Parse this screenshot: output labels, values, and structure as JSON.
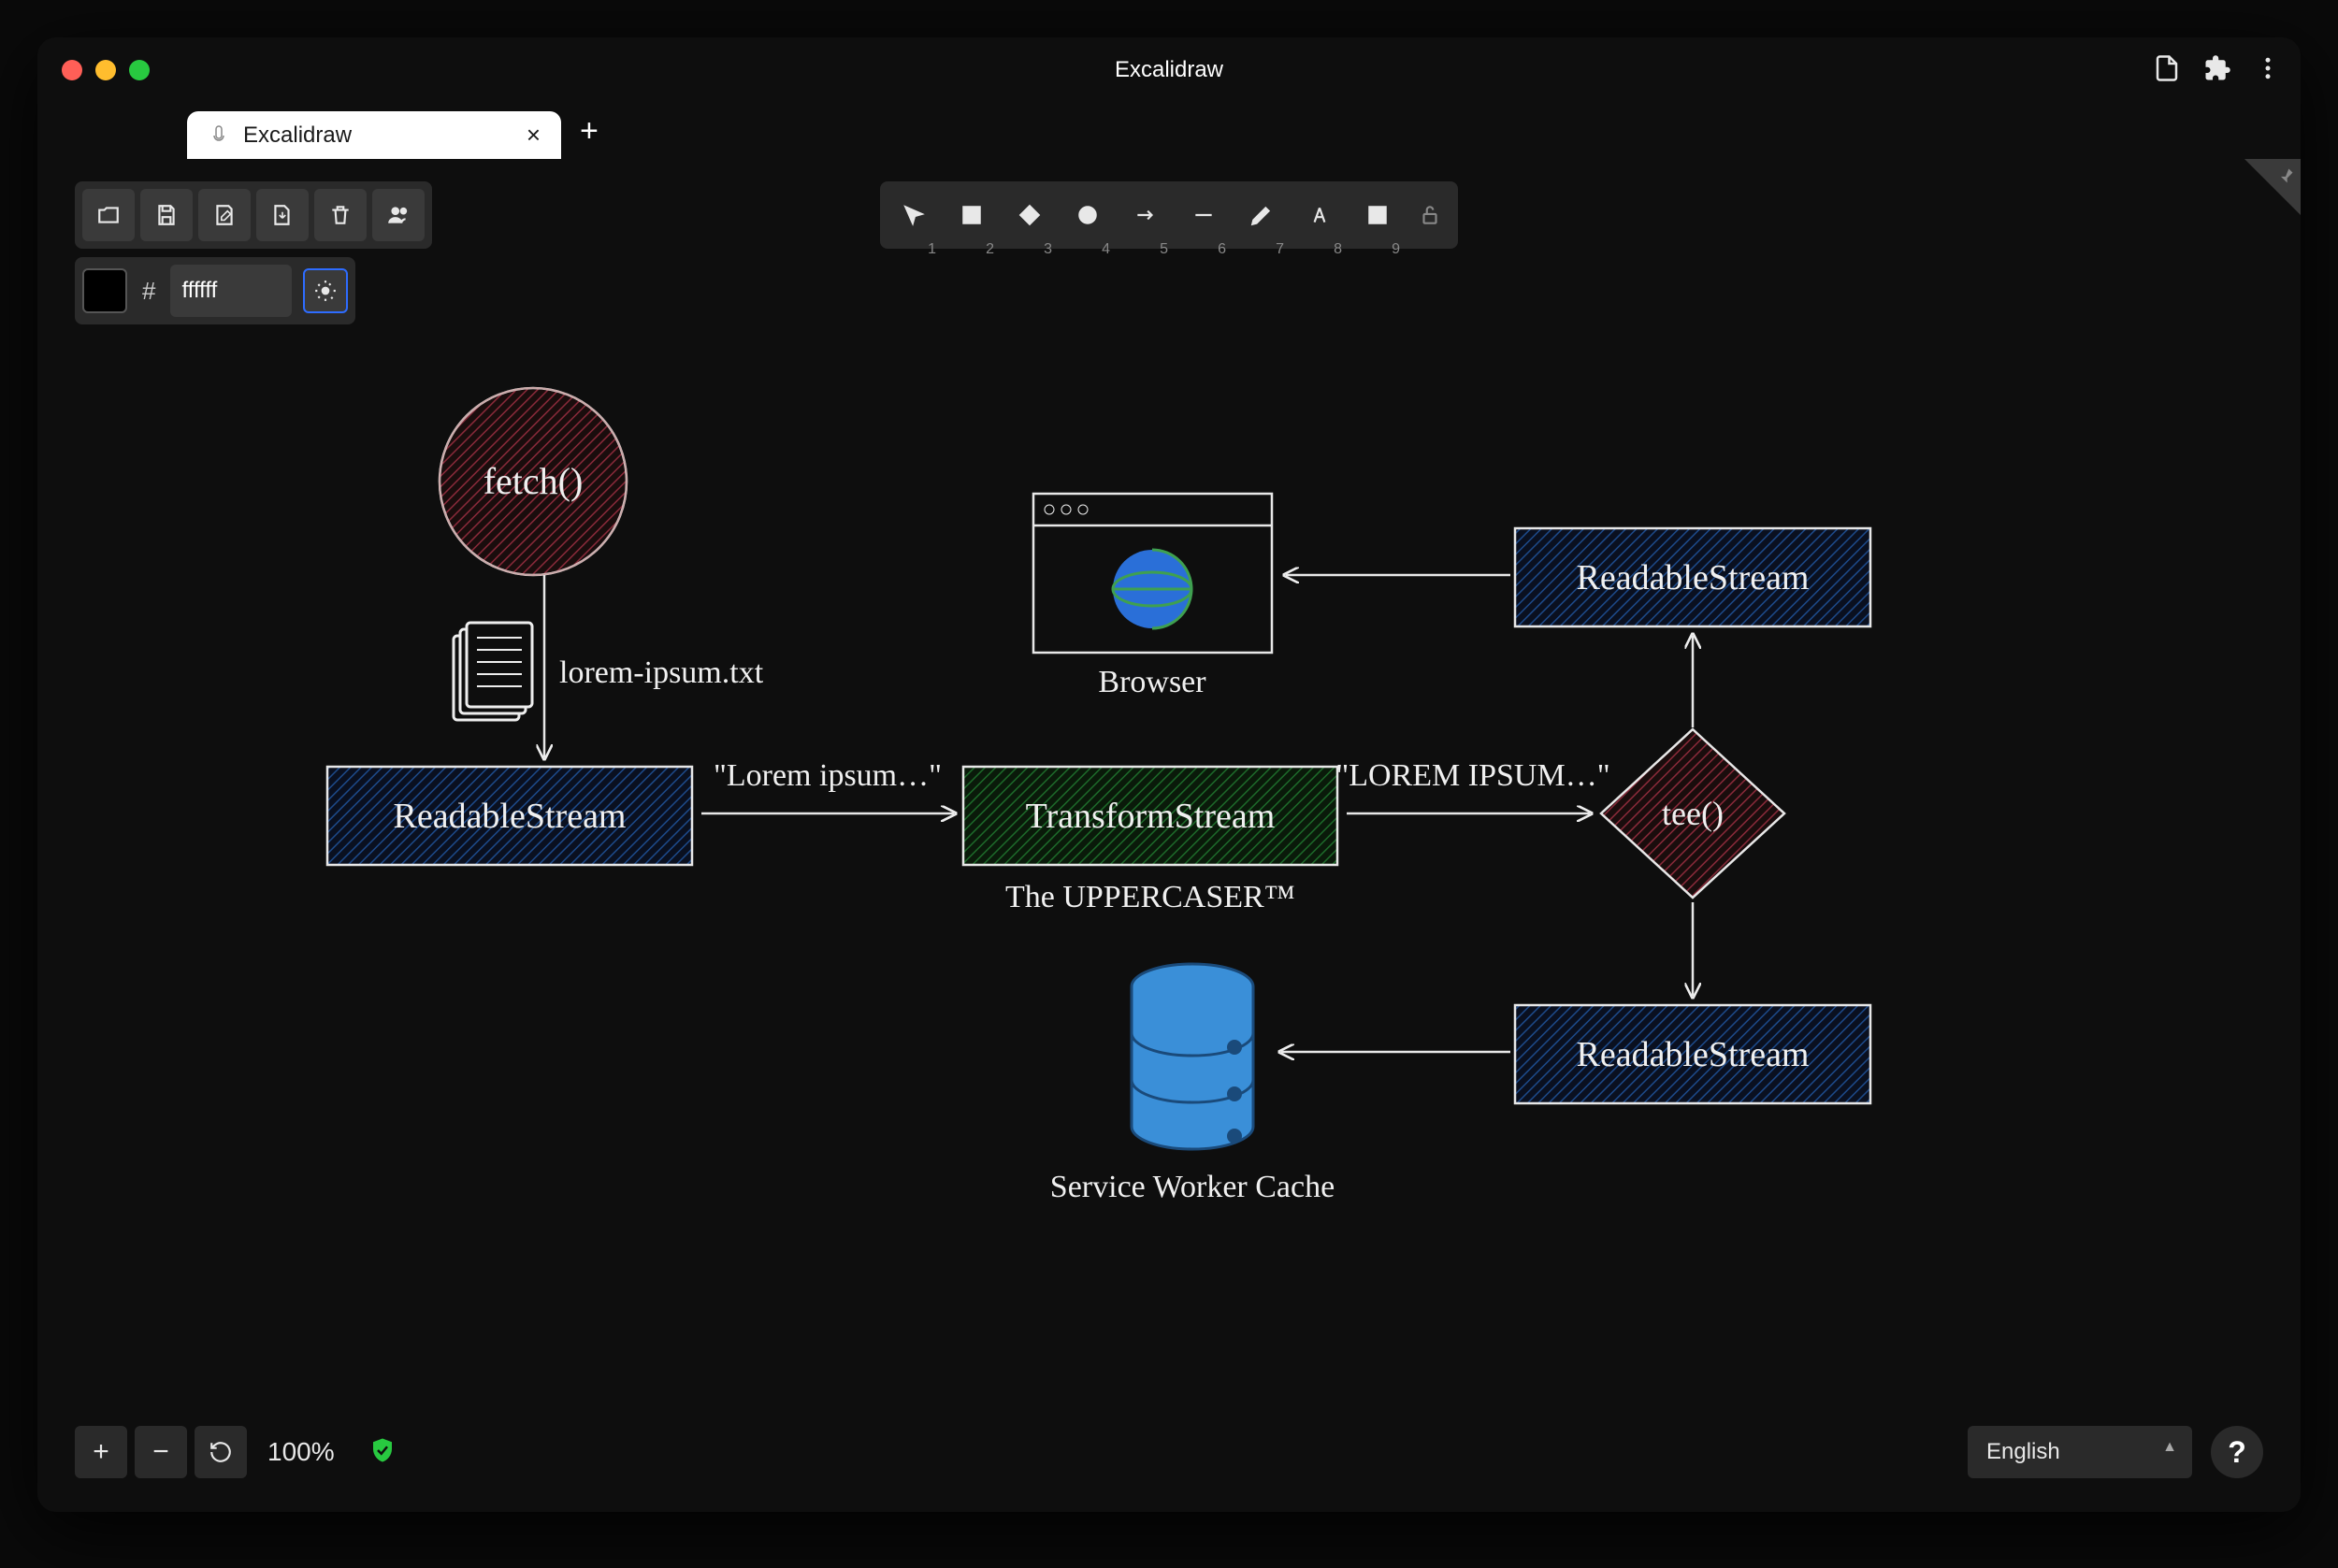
{
  "window": {
    "title": "Excalidraw"
  },
  "tab": {
    "title": "Excalidraw"
  },
  "color": {
    "hex": "ffffff"
  },
  "zoom": {
    "level": "100%"
  },
  "language": {
    "selected": "English"
  },
  "tools": {
    "idx1": "1",
    "idx2": "2",
    "idx3": "3",
    "idx4": "4",
    "idx5": "5",
    "idx6": "6",
    "idx7": "7",
    "idx8": "8",
    "idx9": "9"
  },
  "diagram": {
    "fetch_label": "fetch()",
    "file_label": "lorem-ipsum.txt",
    "readable1": "ReadableStream",
    "arrow1_text": "\"Lorem ipsum…\"",
    "transform": "TransformStream",
    "transform_sub": "The UPPERCASER™",
    "arrow2_text": "\"LOREM IPSUM…\"",
    "tee": "tee()",
    "readable2": "ReadableStream",
    "readable3": "ReadableStream",
    "browser": "Browser",
    "swcache": "Service Worker Cache"
  }
}
